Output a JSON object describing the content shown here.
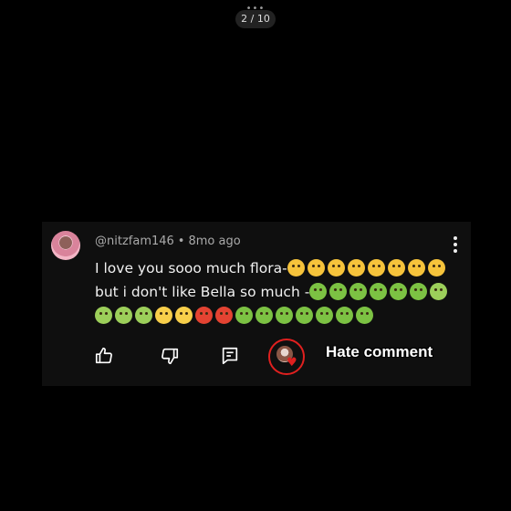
{
  "pager": {
    "dots": "•••",
    "label": "2 / 10"
  },
  "comment": {
    "handle": "@nitzfam146",
    "separator": "•",
    "time": "8mo ago",
    "line1_text": "I love you sooo much flora-",
    "line1_emojis": [
      "kissing-face",
      "kissing-face",
      "kissing-face",
      "kissing-face",
      "kissing-face",
      "kissing-face",
      "kissing-face",
      "kissing-face"
    ],
    "line2_text": "but i don't like Bella so much -",
    "line2_emojis": [
      "vomiting-face",
      "vomiting-face",
      "vomiting-face",
      "vomiting-face",
      "vomiting-face",
      "vomiting-face",
      "nauseated-face"
    ],
    "line3_emojis": [
      "nauseated-face",
      "nauseated-face",
      "nauseated-face",
      "eye-roll-face",
      "eye-roll-face",
      "cursing-face",
      "cursing-face",
      "vomiting-face",
      "vomiting-face",
      "vomiting-face",
      "vomiting-face",
      "vomiting-face",
      "vomiting-face",
      "vomiting-face"
    ]
  },
  "actions": {
    "like_icon": "thumbs-up-icon",
    "dislike_icon": "thumbs-down-icon",
    "reply_icon": "reply-icon",
    "creator_heart_icon": "creator-heart-icon"
  },
  "annotation": {
    "label": "Hate comment",
    "ring_color": "#e0201f"
  }
}
